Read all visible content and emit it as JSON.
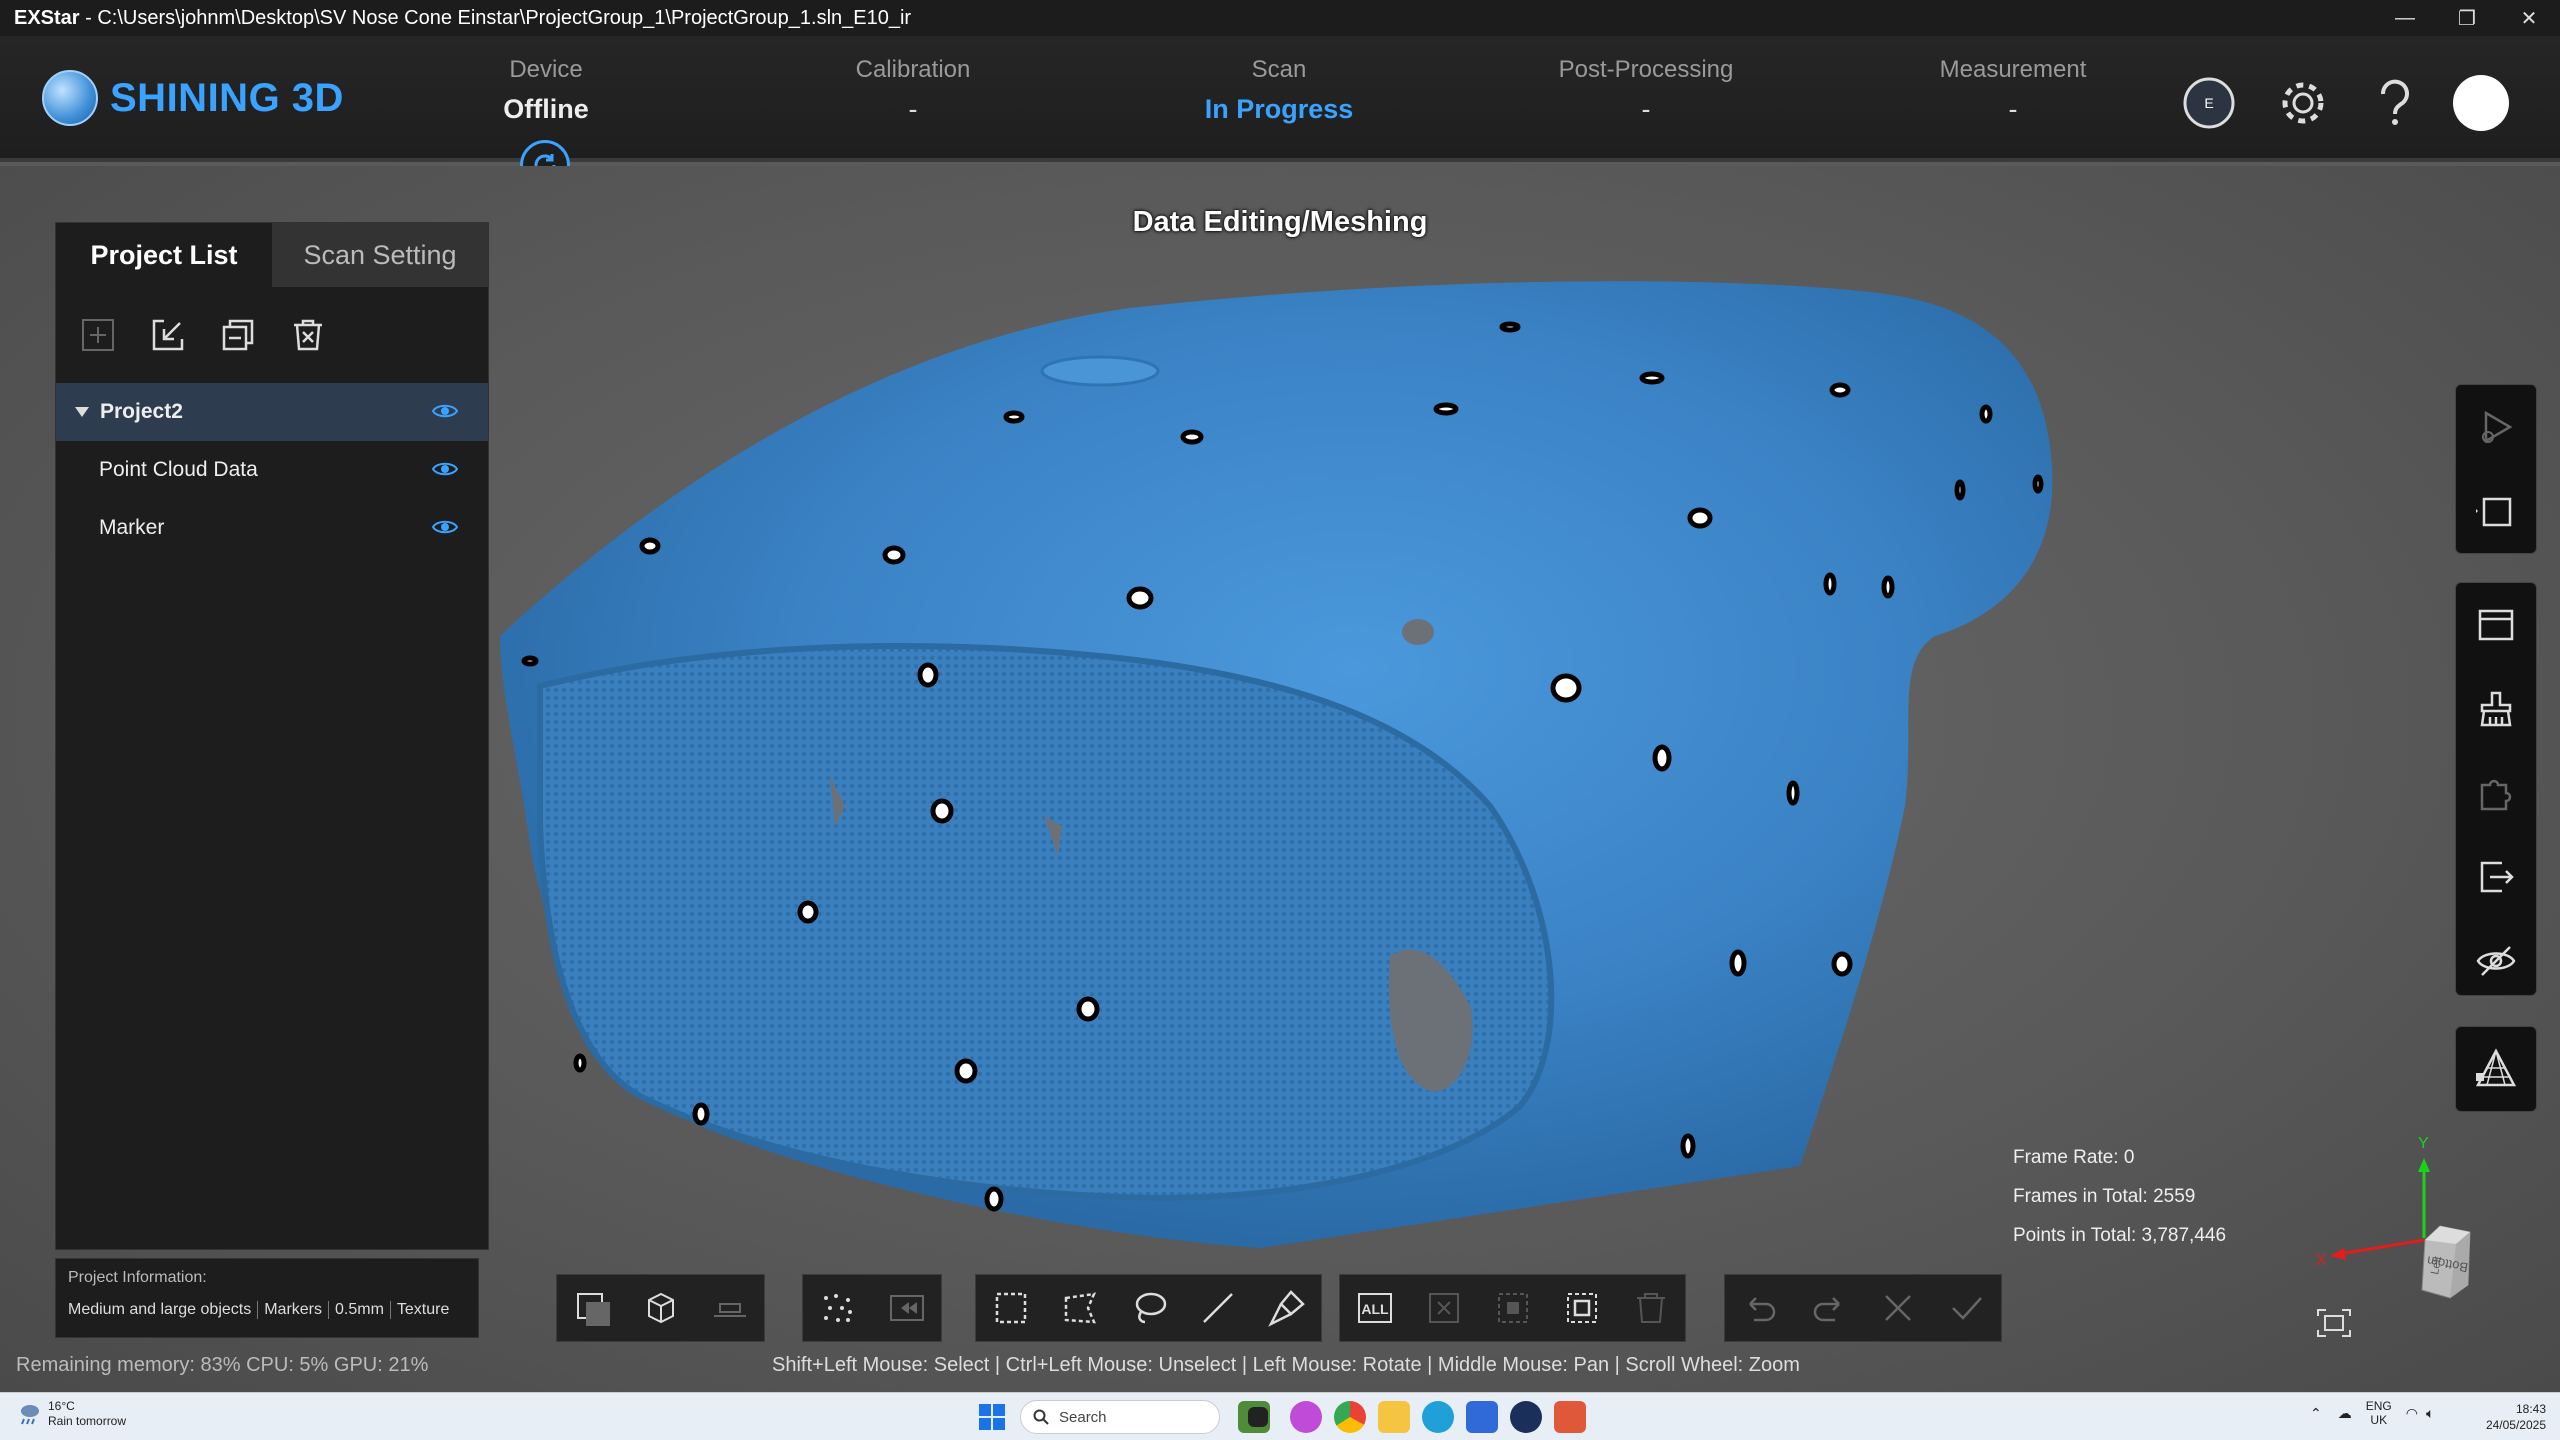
{
  "window": {
    "app_name": "EXStar",
    "title_path": " - C:\\Users\\johnm\\Desktop\\SV Nose Cone Einstar\\ProjectGroup_1\\ProjectGroup_1.sln_E10_ir",
    "minimize_glyph": "—",
    "restore_glyph": "❐",
    "close_glyph": "✕"
  },
  "brand": {
    "name": "SHINING 3D"
  },
  "workflow": {
    "steps": [
      {
        "label": "Device",
        "status": "Offline"
      },
      {
        "label": "Calibration",
        "status": "-"
      },
      {
        "label": "Scan",
        "status": "In Progress"
      },
      {
        "label": "Post-Processing",
        "status": "-"
      },
      {
        "label": "Measurement",
        "status": "-"
      }
    ],
    "current_stage": "Data Editing/Meshing"
  },
  "header_icons": [
    "model-badge-icon",
    "gear-icon",
    "help-icon",
    "user-avatar"
  ],
  "panel": {
    "tabs": [
      "Project List",
      "Scan Setting"
    ],
    "tools": [
      "add-icon",
      "import-icon",
      "duplicate-icon",
      "delete-icon"
    ],
    "tree": [
      {
        "label": "Project2",
        "selected": true,
        "expanded": true
      },
      {
        "label": "Point Cloud Data",
        "selected": false
      },
      {
        "label": "Marker",
        "selected": false
      }
    ]
  },
  "project_info": {
    "heading": "Project Information:",
    "tags": [
      "Medium and large objects",
      "Markers",
      "0.5mm",
      "Texture"
    ]
  },
  "stats": {
    "frame_rate": "Frame Rate: 0",
    "frames_total": "Frames in Total: 2559",
    "points_total": "Points in Total: 3,787,446"
  },
  "axes": {
    "y": "Y",
    "x": "X",
    "face_a": "Bottom",
    "face_b": "Left"
  },
  "status": {
    "left": "Remaining memory: 83% CPU: 5% GPU: 21%",
    "hint": "Shift+Left Mouse: Select | Ctrl+Left Mouse: Unselect | Left Mouse: Rotate | Middle Mouse: Pan | Scroll Wheel: Zoom"
  },
  "toolbar": {
    "all_label": "ALL"
  },
  "taskbar": {
    "weather_temp": "16°C",
    "weather_desc": "Rain tomorrow",
    "search_placeholder": "Search",
    "lang_top": "ENG",
    "lang_bottom": "UK",
    "time": "18:43",
    "date": "24/05/2025"
  },
  "colors": {
    "accent": "#3aa2ff",
    "mesh": "#3b86c9",
    "panel_bg": "#1d1d1d",
    "selected_row": "#2d3c4e"
  }
}
